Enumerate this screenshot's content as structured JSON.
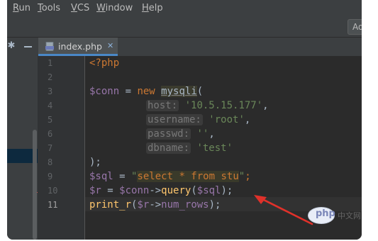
{
  "menu": {
    "items": [
      {
        "label": "Run"
      },
      {
        "label": "Tools"
      },
      {
        "label": "VCS"
      },
      {
        "label": "Window"
      },
      {
        "label": "Help"
      }
    ]
  },
  "toolbar": {
    "button_label": "Ad"
  },
  "tab": {
    "filename": "index.php",
    "close_glyph": "✕"
  },
  "editor": {
    "line_numbers": [
      "1",
      "2",
      "3",
      "4",
      "5",
      "6",
      "7",
      "8",
      "9",
      "10",
      "11"
    ],
    "current_line": 11,
    "code": {
      "l1": "<?php",
      "l3": {
        "var": "$conn",
        "eq": " = ",
        "kw": "new ",
        "cls": "mysqli",
        "paren": "("
      },
      "l4": {
        "hint": "host:",
        "val": "'10.5.15.177'",
        "comma": ","
      },
      "l5": {
        "hint": "username:",
        "val": "'root'",
        "comma": ","
      },
      "l6": {
        "hint": "passwd:",
        "val": "''",
        "comma": ","
      },
      "l7": {
        "hint": "dbname:",
        "val": "'test'"
      },
      "l8": ");",
      "l9": {
        "var": "$sql",
        "eq": " = ",
        "q1": "\"",
        "sql": "select * from stu",
        "q2": "\"",
        "end": ";"
      },
      "l10": {
        "var1": "$r",
        "eq": " = ",
        "var2": "$conn",
        "arrow": "->",
        "fn": "query",
        "open": "(",
        "var3": "$sql",
        "close": ");"
      },
      "l11": {
        "fn": "print_r",
        "open": "(",
        "var": "$r",
        "arrow": "->",
        "prop": "num_rows",
        "close": ");"
      }
    }
  },
  "watermark": {
    "logo_text": "php",
    "site_text": "中文网"
  },
  "colors": {
    "background": "#2b2b2b",
    "keyword": "#cc7832",
    "variable": "#9876aa",
    "string": "#6a8759",
    "function": "#ffc66d",
    "arrow": "#e0312a"
  },
  "icons": [
    "settings-icon",
    "hide-icon",
    "php-file-icon",
    "tab-close-icon",
    "red-arrow-annotation"
  ]
}
